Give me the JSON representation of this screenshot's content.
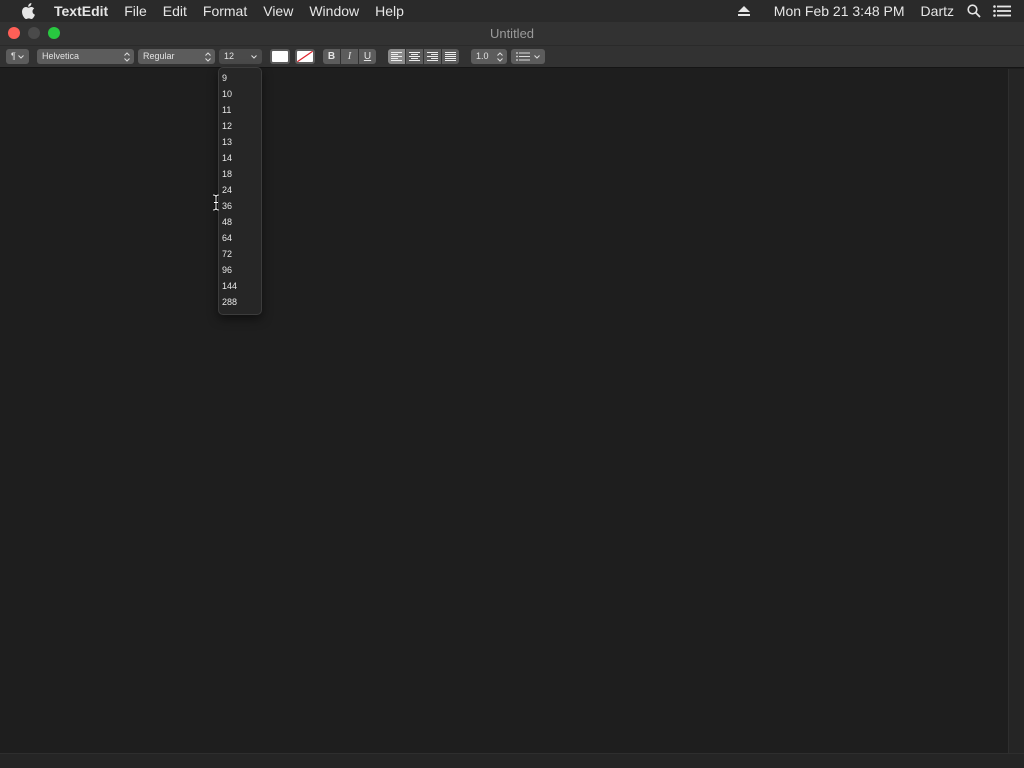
{
  "menubar": {
    "app_name": "TextEdit",
    "menus": [
      "File",
      "Edit",
      "Format",
      "View",
      "Window",
      "Help"
    ],
    "status": {
      "datetime": "Mon Feb 21  3:48 PM",
      "user": "Dartz"
    },
    "icons": [
      "apple-icon",
      "eject-icon",
      "spotlight-search-icon",
      "notification-center-icon"
    ]
  },
  "window": {
    "title": "Untitled"
  },
  "toolbar": {
    "paragraph_symbol": "¶",
    "font_family": "Helvetica",
    "font_style": "Regular",
    "font_size": "12",
    "bold": "B",
    "italic": "I",
    "underline": "U",
    "line_spacing": "1.0",
    "text_color": "#ffffff"
  },
  "font_size_menu": {
    "options": [
      "9",
      "10",
      "11",
      "12",
      "13",
      "14",
      "18",
      "24",
      "36",
      "48",
      "64",
      "72",
      "96",
      "144",
      "288"
    ]
  }
}
